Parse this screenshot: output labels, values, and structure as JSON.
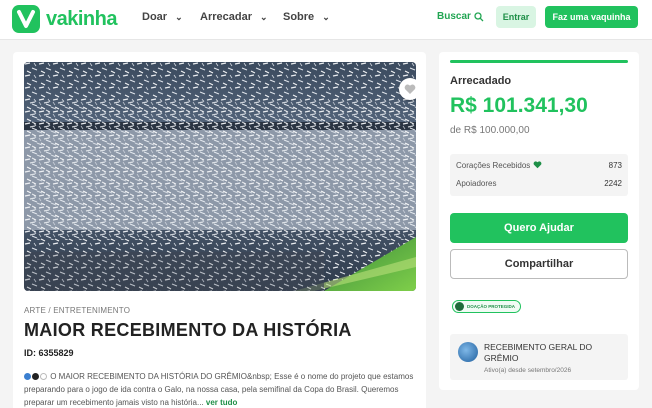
{
  "header": {
    "logo_text": "vakinha",
    "nav": [
      "Doar",
      "Arrecadar",
      "Sobre"
    ],
    "search_label": "Buscar",
    "login_label": "Entrar",
    "create_label": "Faz uma vaquinha"
  },
  "campaign": {
    "favorite_icon": "heart-icon",
    "category": "ARTE / ENTRETENIMENTO",
    "title": "MAIOR RECEBIMENTO DA HISTÓRIA",
    "id_label": "ID: 6355829",
    "description": "O MAIOR RECEBIMENTO DA HISTÓRIA DO GRÊMIO&nbsp; Esse é o nome do projeto que estamos preparando para o jogo de ida contra o Galo, na nossa casa, pela semifinal da Copa do Brasil. Queremos preparar um recebimento jamais visto na história...",
    "read_more": "ver tudo"
  },
  "donation": {
    "progress_fraction": 1.0,
    "raised_label": "Arrecadado",
    "raised_value": "R$ 101.341,30",
    "goal": "de R$ 100.000,00",
    "hearts_label": "Corações Recebidos",
    "hearts_count": "873",
    "supporters_label": "Apoiadores",
    "supporters_count": "2242",
    "help_button": "Quero Ajudar",
    "share_button": "Compartilhar",
    "protected_badge": "DOAÇÃO PROTEGIDA"
  },
  "organizer": {
    "name": "RECEBIMENTO GERAL DO GRÊMIO",
    "since": "Ativo(a) desde setembro/2026"
  },
  "colors": {
    "brand_green": "#21c25e",
    "brand_dark_green": "#1e8f47",
    "light_green": "#d9f5e3"
  }
}
